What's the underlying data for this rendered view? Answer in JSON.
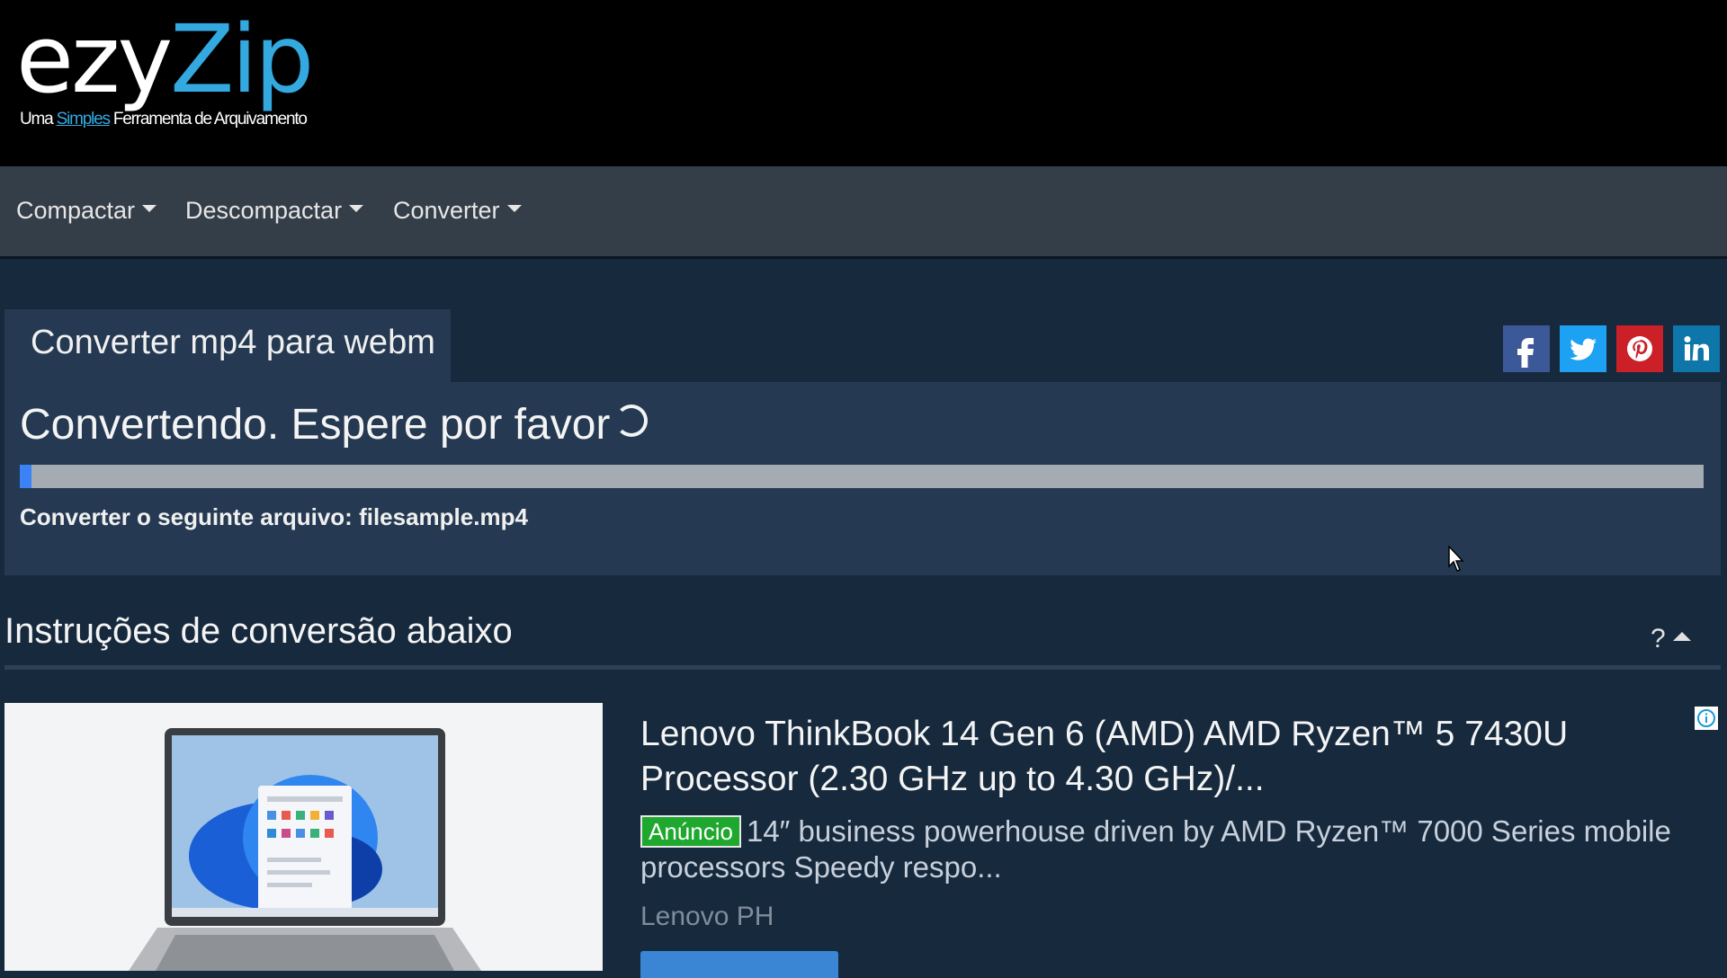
{
  "header": {
    "logo_part1": "ezy",
    "logo_part2": "Zip",
    "tagline_before": "Uma",
    "tagline_highlight": "Simples",
    "tagline_after": "Ferramenta de Arquivamento"
  },
  "nav": {
    "items": [
      {
        "label": "Compactar"
      },
      {
        "label": "Descompactar"
      },
      {
        "label": "Converter"
      }
    ]
  },
  "tab": {
    "title": "Converter mp4 para webm"
  },
  "social": {
    "buttons": [
      {
        "name": "facebook",
        "icon": "facebook-icon",
        "color": "#3b5998"
      },
      {
        "name": "twitter",
        "icon": "twitter-icon",
        "color": "#1da1f2"
      },
      {
        "name": "pinterest",
        "icon": "pinterest-icon",
        "color": "#cb2027"
      },
      {
        "name": "linkedin",
        "icon": "linkedin-icon",
        "color": "#0e76a8"
      }
    ]
  },
  "conversion": {
    "status": "Convertendo. Espere por favor",
    "progress_fraction": 0.007,
    "file_label": "Converter o seguinte arquivo: filesample.mp4"
  },
  "instructions": {
    "heading": "Instruções de conversão abaixo",
    "help": "?"
  },
  "ad": {
    "title": "Lenovo ThinkBook 14 Gen 6 (AMD) AMD Ryzen™ 5 7430U Processor (2.30 GHz up to 4.30 GHz)/...",
    "badge": "Anúncio",
    "description": "14″ business powerhouse driven by AMD Ryzen™ 7000 Series mobile processors Speedy respo...",
    "source": "Lenovo PH"
  },
  "colors": {
    "accent": "#33a9e0",
    "progress": "#3b82f6",
    "badge": "#1fa82e"
  }
}
